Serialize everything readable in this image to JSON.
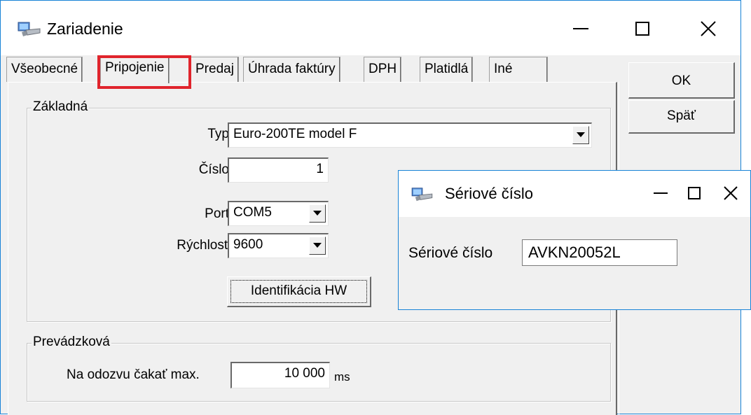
{
  "main_window": {
    "title": "Zariadenie",
    "minimize_glyph": "—",
    "maximize_glyph": "☐",
    "close_glyph": "✕"
  },
  "tabs": [
    {
      "label": "Všeobecné",
      "active": false
    },
    {
      "label": "Pripojenie",
      "active": true
    },
    {
      "label": "Predaj",
      "active": false
    },
    {
      "label": "Úhrada faktúry",
      "active": false
    },
    {
      "label": "DPH",
      "active": false
    },
    {
      "label": "Platidlá",
      "active": false
    },
    {
      "label": "Iné",
      "active": false
    }
  ],
  "buttons": {
    "ok": "OK",
    "back": "Späť",
    "identify_hw": "Identifikácia HW"
  },
  "group_basic": {
    "title": "Základná",
    "type_label": "Typ",
    "type_value": "Euro-200TE model F",
    "number_label": "Číslo",
    "number_value": "1",
    "port_label": "Port",
    "port_value": "COM5",
    "speed_label": "Rýchlosť",
    "speed_value": "9600"
  },
  "group_operational": {
    "title": "Prevádzková",
    "timeout_label": "Na odozvu čakať max.",
    "timeout_value": "10 000",
    "timeout_unit": "ms"
  },
  "popup": {
    "title": "Sériové číslo",
    "field_label": "Sériové číslo",
    "field_value": "AVKN20052L"
  },
  "colors": {
    "window_border": "#1883d7",
    "highlight": "#e0242c",
    "face": "#f0f0f0"
  }
}
